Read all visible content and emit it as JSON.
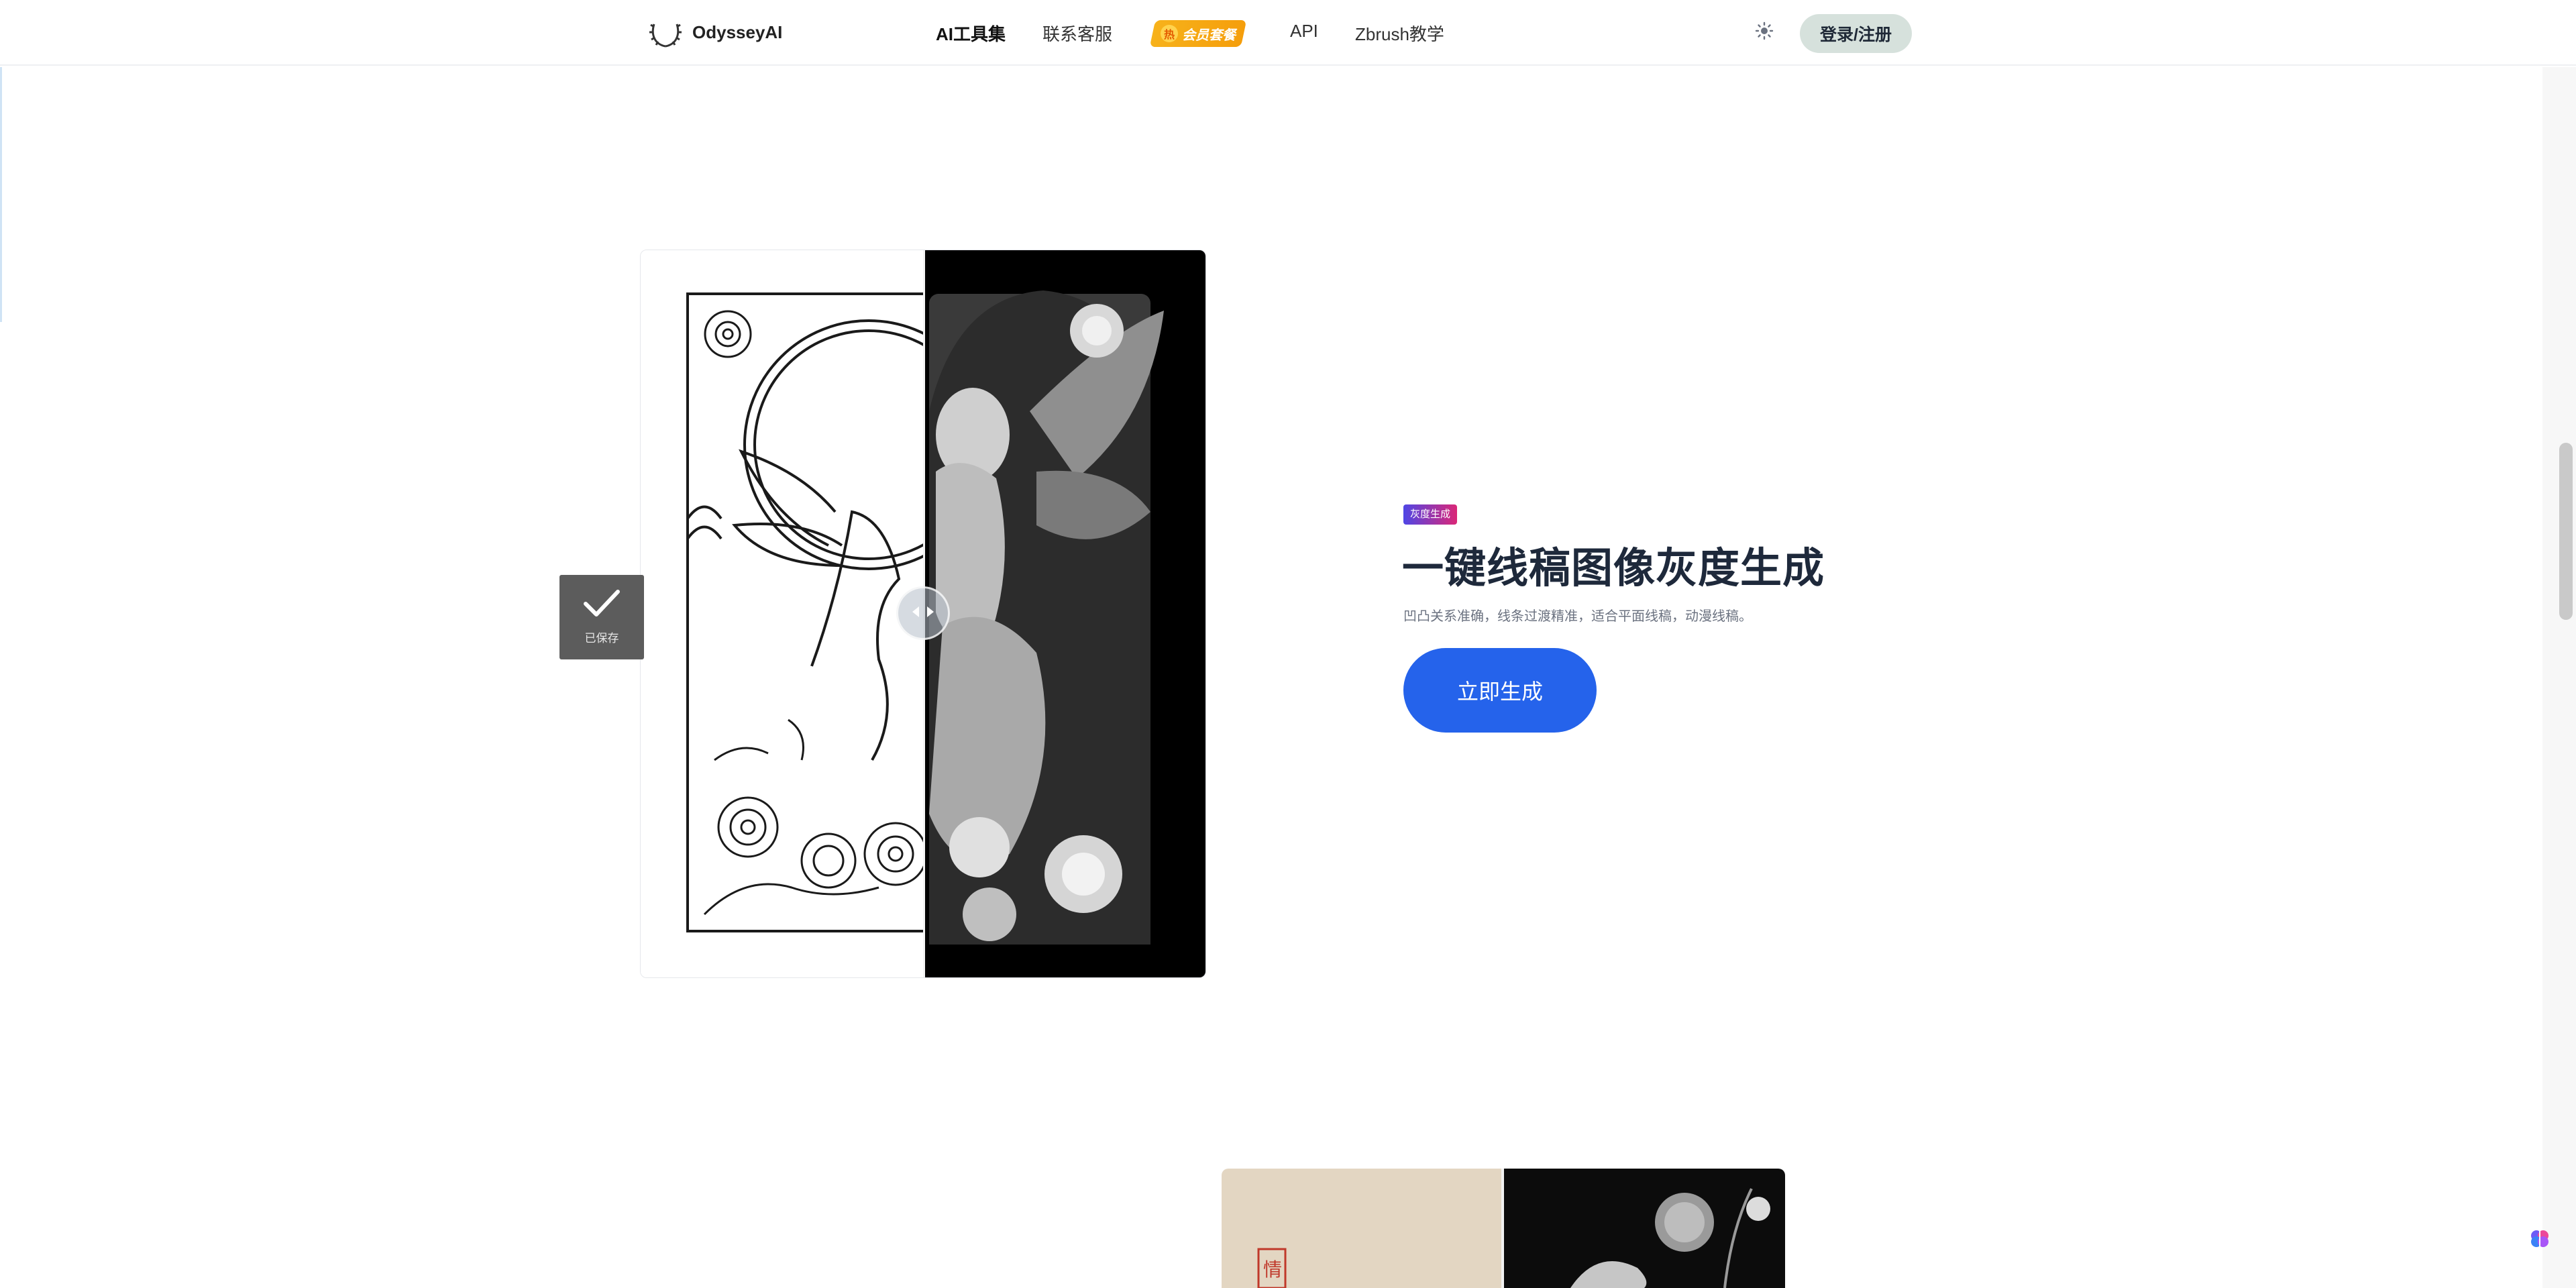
{
  "nav": {
    "brand": "OdysseyAI",
    "items": [
      "AI工具集",
      "联系客服",
      "API",
      "Zbrush教学"
    ],
    "badge_text": "会员套餐",
    "badge_hot": "热",
    "login": "登录/注册"
  },
  "compare": {
    "saved_label": "已保存"
  },
  "feature": {
    "tag": "灰度生成",
    "title": "一键线稿图像灰度生成",
    "desc": "凹凸关系准确，线条过渡精准，适合平面线稿，动漫线稿。",
    "cta": "立即生成"
  },
  "next_card": {
    "seal_text": "情"
  },
  "colors": {
    "primary": "#2563eb",
    "tag_gradient_start": "#4f46e5",
    "tag_gradient_end": "#db2777",
    "badge": "#f59e0b",
    "login_bg": "#d6e1dc"
  },
  "icons": [
    "laurel-logo-icon",
    "sun-icon",
    "check-icon",
    "split-arrows-icon",
    "brain-icon"
  ]
}
